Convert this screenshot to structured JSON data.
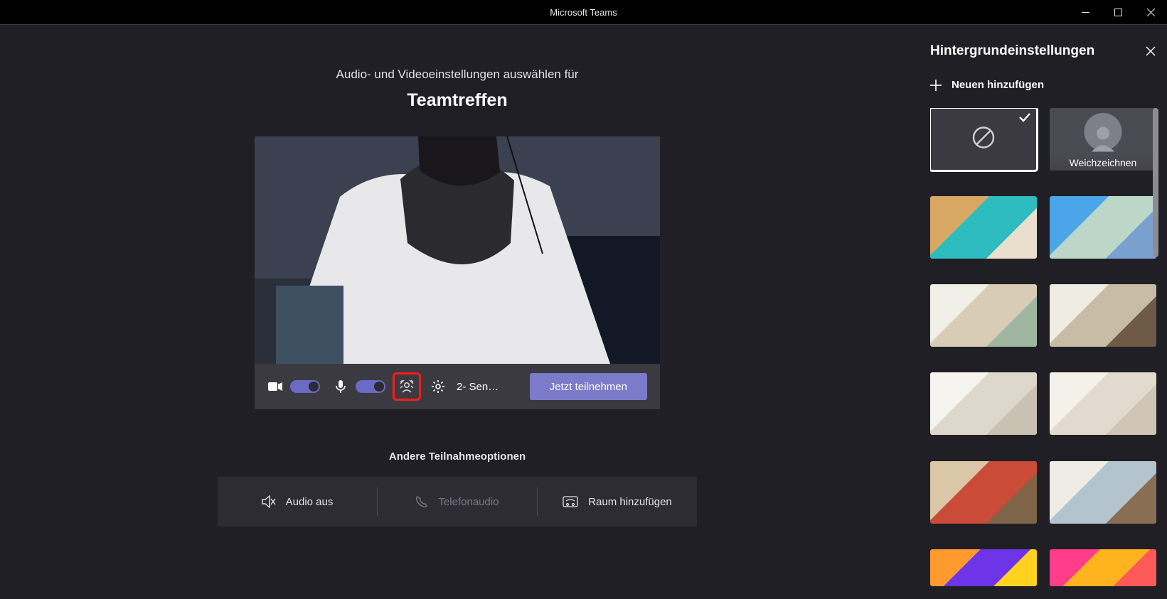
{
  "window": {
    "title": "Microsoft Teams"
  },
  "main": {
    "subtitle": "Audio- und Videoeinstellungen auswählen für",
    "meeting_name": "Teamtreffen",
    "device_label": "2- Sen…",
    "join_label": "Jetzt teilnehmen",
    "other_title": "Andere Teilnahmeoptionen",
    "options": {
      "audio_off": "Audio aus",
      "phone_audio": "Telefonaudio",
      "add_room": "Raum hinzufügen"
    },
    "camera_on": true,
    "mic_on": true
  },
  "panel": {
    "title": "Hintergrundeinstellungen",
    "add_new": "Neuen hinzufügen",
    "items": [
      {
        "kind": "none",
        "selected": true
      },
      {
        "kind": "blur",
        "label": "Weichzeichnen"
      },
      {
        "kind": "image",
        "colors": [
          "#d8a862",
          "#2fbcc1",
          "#e9dfcc"
        ]
      },
      {
        "kind": "image",
        "colors": [
          "#4aa6e8",
          "#bcd6c8",
          "#7aa0cf"
        ]
      },
      {
        "kind": "image",
        "colors": [
          "#f0efe8",
          "#d9ccb6",
          "#9fb6a0"
        ]
      },
      {
        "kind": "image",
        "colors": [
          "#efece3",
          "#c9bca6",
          "#6e5a46"
        ]
      },
      {
        "kind": "image",
        "colors": [
          "#f6f4ef",
          "#ddd7cc",
          "#c9c1b2"
        ]
      },
      {
        "kind": "image",
        "colors": [
          "#f4f1ea",
          "#e2dace",
          "#cfc5b5"
        ]
      },
      {
        "kind": "image",
        "colors": [
          "#d9c7a7",
          "#c94b38",
          "#7e6549"
        ]
      },
      {
        "kind": "image",
        "colors": [
          "#efece6",
          "#b4c4cf",
          "#8a6e54"
        ]
      },
      {
        "kind": "image",
        "colors": [
          "#ff9a2e",
          "#6e34e8",
          "#ffd21f"
        ],
        "half": true
      },
      {
        "kind": "image",
        "colors": [
          "#ff3d8a",
          "#ffb31f",
          "#ff5a5a"
        ],
        "half": true
      }
    ]
  }
}
